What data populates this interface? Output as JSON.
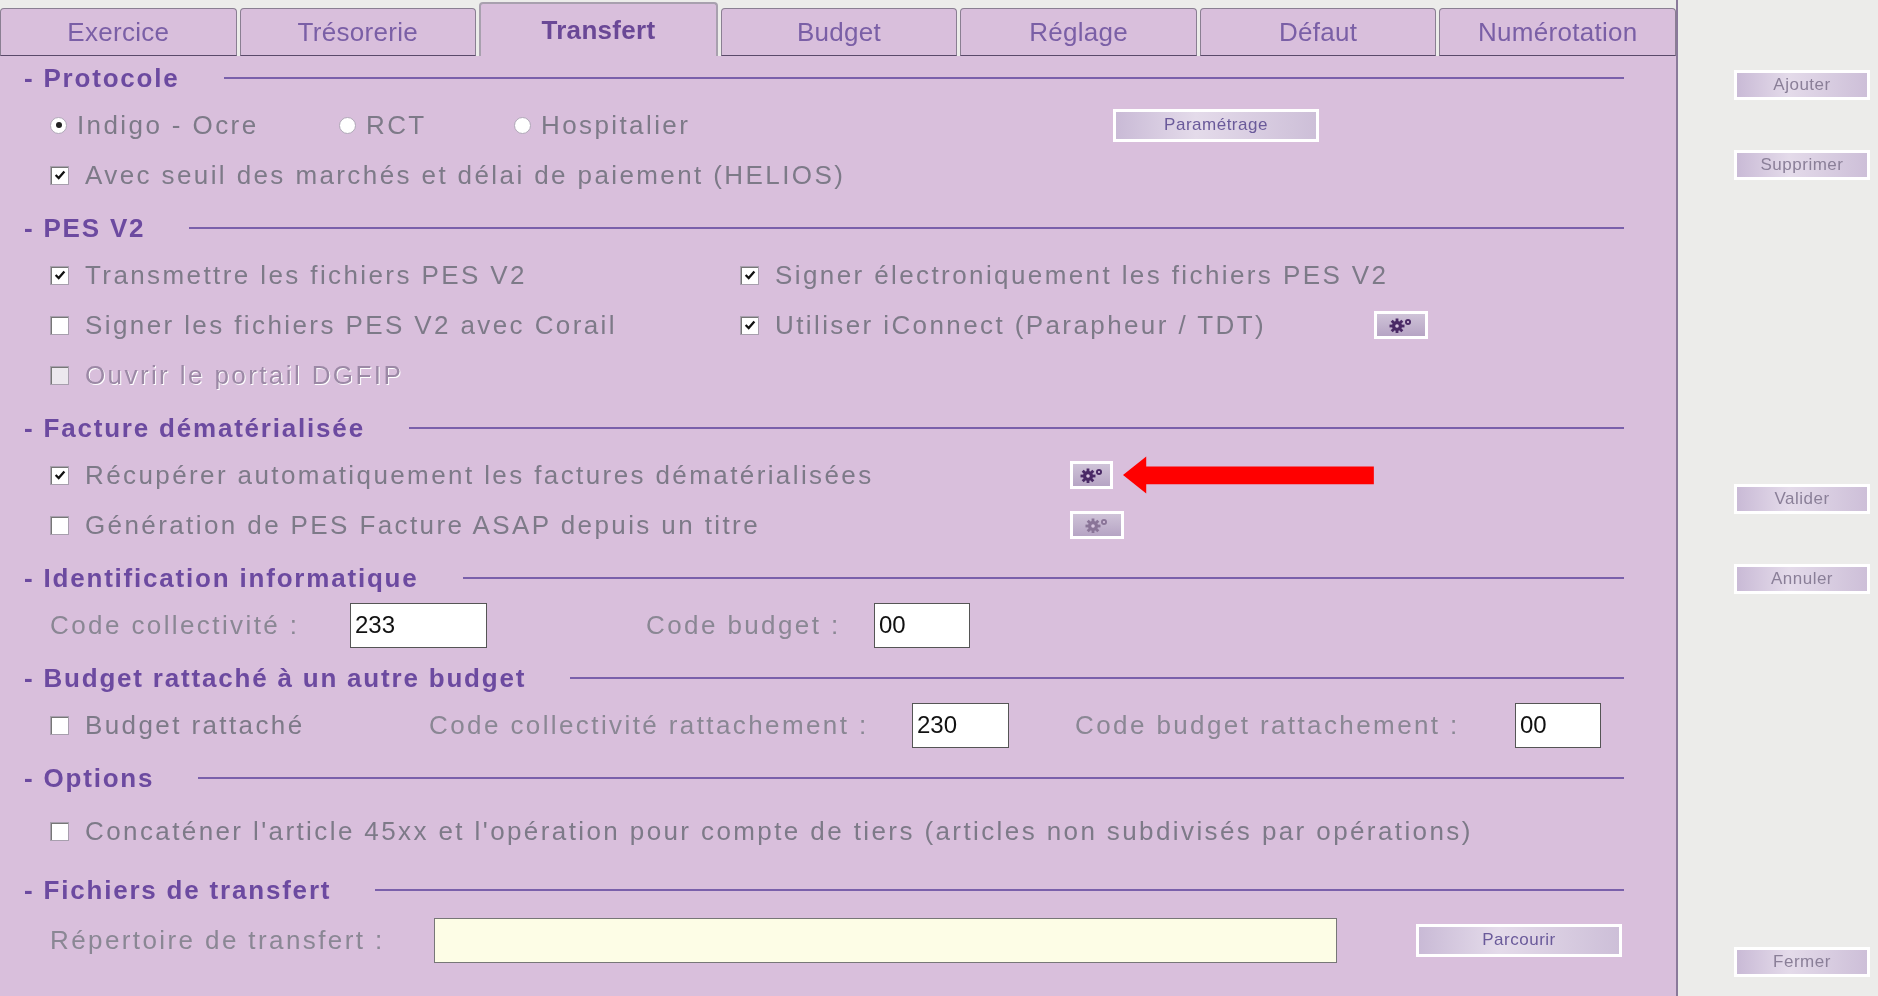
{
  "tabs": [
    {
      "label": "Exercice",
      "selected": false
    },
    {
      "label": "Trésorerie",
      "selected": false
    },
    {
      "label": "Transfert",
      "selected": true
    },
    {
      "label": "Budget",
      "selected": false
    },
    {
      "label": "Réglage",
      "selected": false
    },
    {
      "label": "Défaut",
      "selected": false
    },
    {
      "label": "Numérotation",
      "selected": false
    }
  ],
  "sections": [
    {
      "title": "- Protocole",
      "rows": [
        {
          "kind": "radios",
          "options": [
            {
              "label": "Indigo - Ocre",
              "selected": true
            },
            {
              "label": "RCT",
              "selected": false
            },
            {
              "label": "Hospitalier",
              "selected": false
            }
          ],
          "button": "Paramétrage"
        },
        {
          "kind": "checks",
          "items": [
            {
              "label": "Avec seuil des marchés et délai de paiement (HELIOS)",
              "checked": true,
              "disabled": false
            }
          ]
        }
      ]
    },
    {
      "title": "- PES V2",
      "rows": [
        {
          "kind": "checks",
          "items": [
            {
              "label": "Transmettre les fichiers PES V2",
              "checked": true,
              "disabled": false
            },
            {
              "label": "Signer électroniquement les fichiers PES V2",
              "checked": true,
              "disabled": false
            }
          ]
        },
        {
          "kind": "checks",
          "items": [
            {
              "label": "Signer les fichiers PES V2 avec Corail",
              "checked": false,
              "disabled": false
            },
            {
              "label": "Utiliser iConnect (Parapheur / TDT)",
              "checked": true,
              "disabled": false
            }
          ],
          "gear": {
            "disabled": false
          }
        },
        {
          "kind": "checks",
          "items": [
            {
              "label": "Ouvrir le portail DGFIP",
              "checked": false,
              "disabled": true
            }
          ]
        }
      ]
    },
    {
      "title": "- Facture dématérialisée",
      "rows": [
        {
          "kind": "checks",
          "items": [
            {
              "label": "Récupérer automatiquement les factures dématérialisées",
              "checked": true,
              "disabled": false
            }
          ],
          "gear": {
            "disabled": false
          },
          "annotation": {
            "kind": "arrow"
          }
        },
        {
          "kind": "checks",
          "items": [
            {
              "label": "Génération de PES Facture ASAP depuis un titre",
              "checked": false,
              "disabled": false
            }
          ],
          "gear": {
            "disabled": true
          }
        }
      ]
    },
    {
      "title": "- Identification informatique",
      "rows": [
        {
          "kind": "fields",
          "fields": [
            {
              "label": "Code collectivité :",
              "value": "233"
            },
            {
              "label": "Code budget :",
              "value": "00"
            }
          ]
        }
      ]
    },
    {
      "title": "- Budget rattaché à un autre budget",
      "rows": [
        {
          "kind": "attached",
          "check": {
            "label": "Budget rattaché",
            "checked": false
          },
          "fields": [
            {
              "label": "Code collectivité rattachement :",
              "value": "230"
            },
            {
              "label": "Code budget rattachement :",
              "value": "00"
            }
          ]
        }
      ]
    },
    {
      "title": "- Options",
      "rows": [
        {
          "kind": "checks",
          "items": [
            {
              "label": "Concaténer l'article 45xx et l'opération pour compte de tiers (articles non subdivisés par opérations)",
              "checked": false,
              "disabled": false
            }
          ]
        }
      ]
    },
    {
      "title": "- Fichiers de transfert",
      "rows": [
        {
          "kind": "path",
          "label": "Répertoire de transfert :",
          "value": "",
          "button": "Parcourir"
        }
      ]
    }
  ],
  "side_buttons": [
    [
      "Ajouter",
      "Supprimer"
    ],
    [
      "Valider",
      "Annuler"
    ],
    [
      "Fermer"
    ]
  ]
}
